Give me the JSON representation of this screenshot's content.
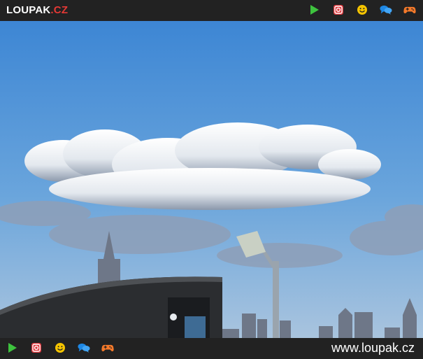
{
  "header": {
    "logo_main": "LOUPAK",
    "logo_domain": ".CZ",
    "icons": [
      "play-icon",
      "instagram-icon",
      "smiley-icon",
      "chat-icon",
      "gamepad-icon"
    ],
    "colors": {
      "play": "#3ec33e",
      "instagram": "#e0393e",
      "smiley": "#f5c400",
      "chat": "#1e88e5",
      "gamepad": "#f4792a"
    }
  },
  "footer": {
    "site_url": "www.loupak.cz",
    "icons": [
      "play-icon",
      "instagram-icon",
      "smiley-icon",
      "chat-icon",
      "gamepad-icon"
    ]
  },
  "image": {
    "description_icon": "photo-sky-cloud-city-skyline"
  }
}
